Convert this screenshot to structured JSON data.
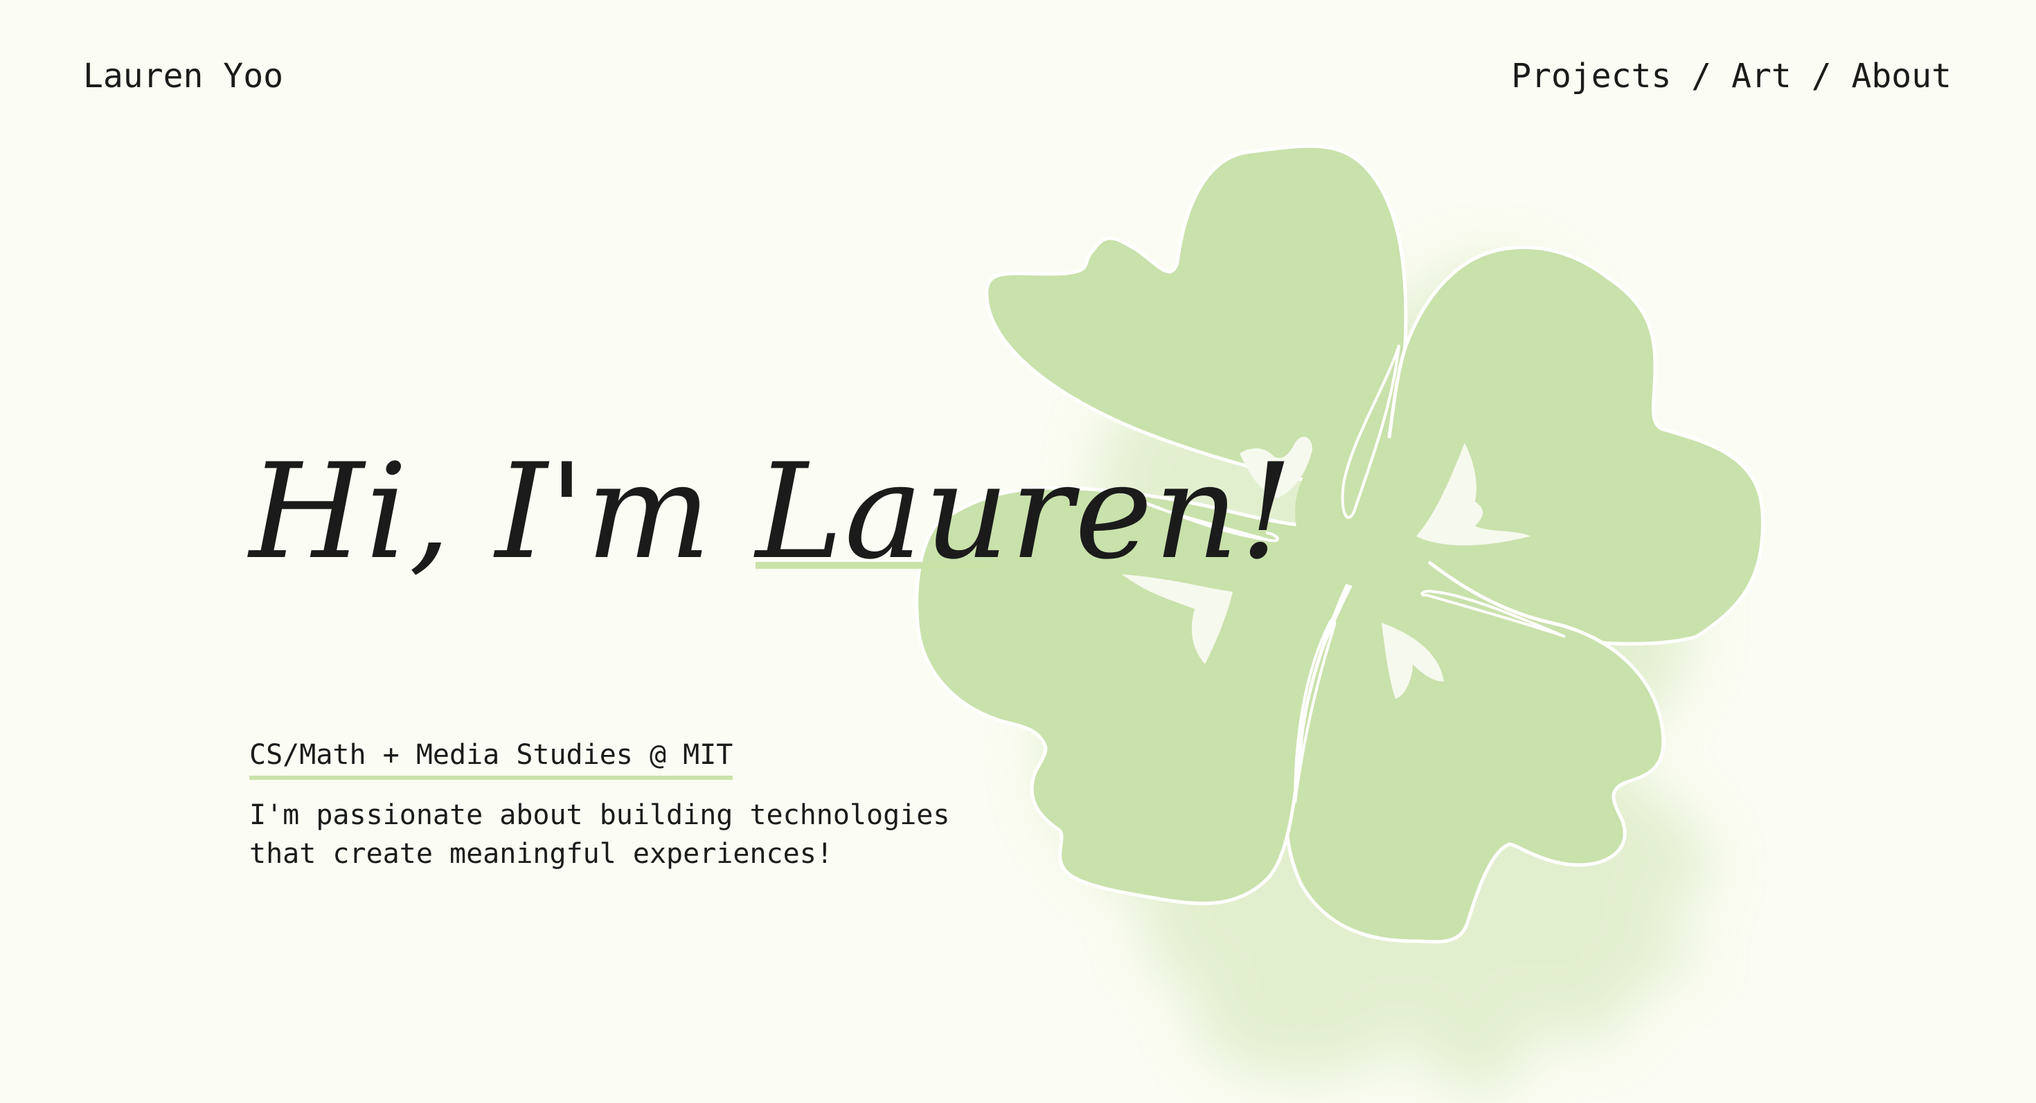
{
  "header": {
    "site_name": "Lauren Yoo",
    "nav": [
      {
        "label": "Projects"
      },
      {
        "label": "Art"
      },
      {
        "label": "About"
      }
    ],
    "separator": " / "
  },
  "hero": {
    "greeting": "Hi, I'm ",
    "name": "Lauren!",
    "subtitle": "CS/Math + Media Studies @ MIT",
    "bio_lines": [
      "I'm passionate about building technologies",
      "that create meaningful experiences!"
    ]
  },
  "theme": {
    "background": "#fbfcf3",
    "accent_green": "#c8e2a8",
    "text": "#1b1b1b",
    "petal_line": "#ffffff"
  },
  "illustration": {
    "icon": "flower-illustration-icon"
  }
}
